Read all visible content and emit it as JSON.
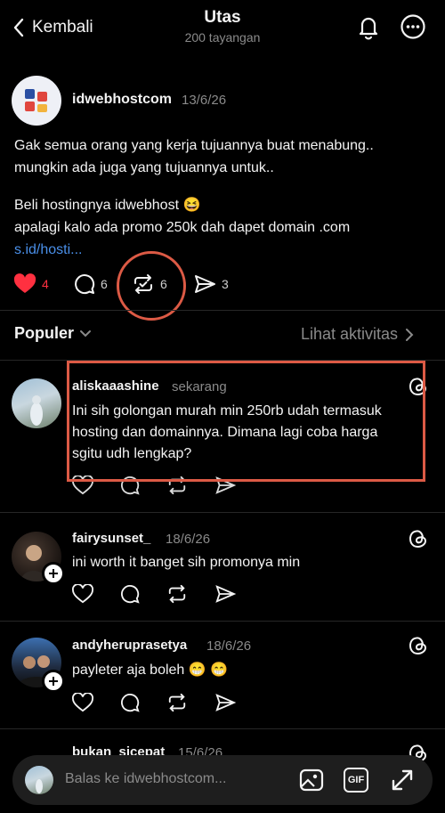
{
  "header": {
    "back_label": "Kembali",
    "title": "Utas",
    "subtitle": "200 tayangan"
  },
  "post": {
    "username": "idwebhostcom",
    "date": "13/6/26",
    "paragraph1": [
      "Gak semua orang yang kerja tujuannya buat menabung..",
      "mungkin ada juga yang tujuannya untuk.."
    ],
    "paragraph2": [
      "Beli hostingnya idwebhost 😆",
      "apalagi kalo ada promo 250k dah dapet domain .com"
    ],
    "link": "s.id/hosti...",
    "likes": "4",
    "comments": "6",
    "reposts": "6",
    "shares": "3"
  },
  "sort": {
    "label": "Populer",
    "activity_link": "Lihat aktivitas"
  },
  "replies": [
    {
      "username": "aliskaaashine",
      "time": "sekarang",
      "text": [
        "Ini sih golongan murah min 250rb udah termasuk",
        "hosting dan domainnya. Dimana lagi coba harga",
        "sgitu udh lengkap?"
      ]
    },
    {
      "username": "fairysunset_",
      "time": "18/6/26",
      "text": [
        "ini worth it banget sih promonya min"
      ]
    },
    {
      "username": "andyheruprasetya",
      "time": "18/6/26",
      "text": [
        "payleter aja boleh 😁 😁"
      ]
    },
    {
      "username": "bukan_sicepat",
      "time": "15/6/26",
      "text": []
    }
  ],
  "reply_bar": {
    "placeholder": "Balas ke idwebhostcom...",
    "gif_label": "GIF"
  },
  "colors": {
    "background": "#000000",
    "like_red": "#ff3040",
    "link_blue": "#4a8fe8",
    "annotation_red": "#dc5a45"
  }
}
